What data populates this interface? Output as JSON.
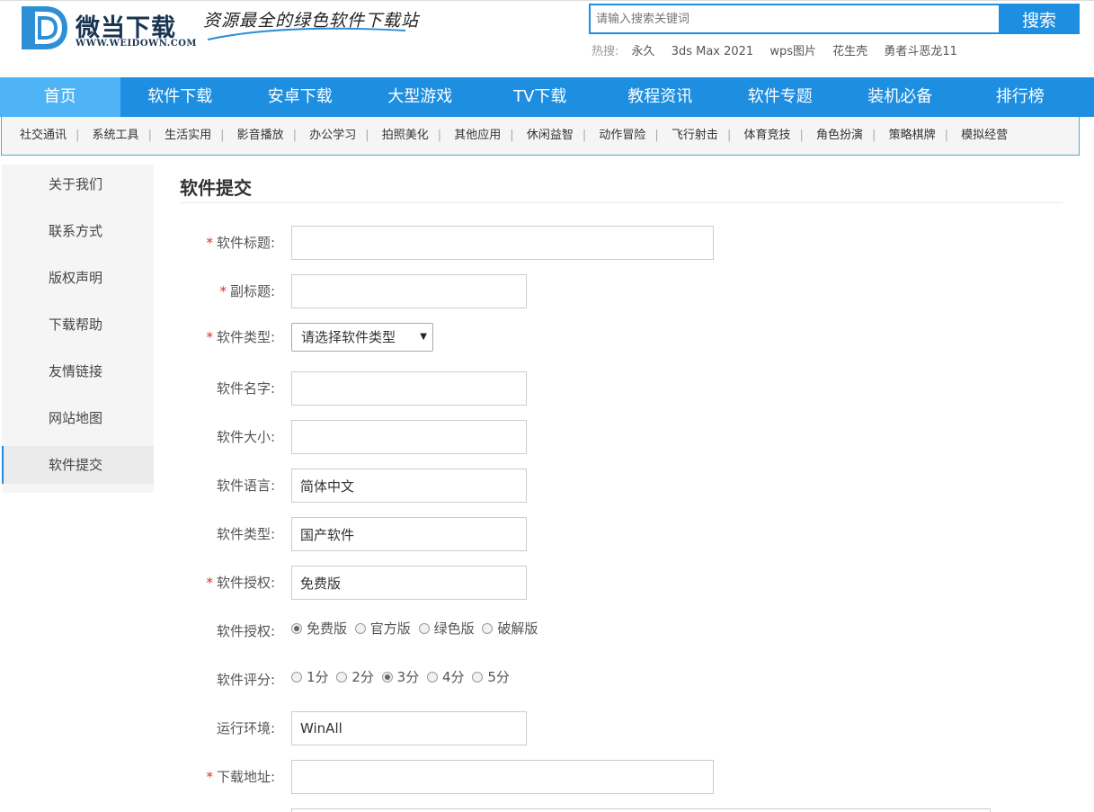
{
  "header": {
    "logo_name": "微当下载",
    "logo_url": "WWW.WEIDOWN.COM",
    "slogan": "资源最全的绿色软件下载站",
    "search": {
      "placeholder": "请输入搜索关键词",
      "button": "搜索"
    },
    "hot": {
      "label": "热搜:",
      "keywords": [
        "永久",
        "3ds Max 2021",
        "wps图片",
        "花生壳",
        "勇者斗恶龙11"
      ]
    }
  },
  "nav": {
    "items": [
      "首页",
      "软件下载",
      "安卓下载",
      "大型游戏",
      "TV下载",
      "教程资讯",
      "软件专题",
      "装机必备",
      "排行榜"
    ],
    "active": "首页"
  },
  "subnav": {
    "items": [
      "社交通讯",
      "系统工具",
      "生活实用",
      "影音播放",
      "办公学习",
      "拍照美化",
      "其他应用",
      "休闲益智",
      "动作冒险",
      "飞行射击",
      "体育竞技",
      "角色扮演",
      "策略棋牌",
      "模拟经营"
    ],
    "separator": "|"
  },
  "sidebar": {
    "items": [
      "关于我们",
      "联系方式",
      "版权声明",
      "下载帮助",
      "友情链接",
      "网站地图",
      "软件提交"
    ],
    "active": "软件提交"
  },
  "form": {
    "title": "软件提交",
    "required_mark": "*",
    "fields": {
      "title": {
        "label": "软件标题:",
        "value": ""
      },
      "subtitle": {
        "label": "副标题:",
        "value": ""
      },
      "category": {
        "label": "软件类型:",
        "selected": "请选择软件类型",
        "caret": "▼"
      },
      "name": {
        "label": "软件名字:",
        "value": ""
      },
      "size": {
        "label": "软件大小:",
        "value": ""
      },
      "language": {
        "label": "软件语言:",
        "value": "简体中文"
      },
      "type": {
        "label": "软件类型:",
        "value": "国产软件"
      },
      "license": {
        "label": "软件授权:",
        "value": "免费版"
      },
      "license_radio": {
        "label": "软件授权:",
        "options": [
          "免费版",
          "官方版",
          "绿色版",
          "破解版"
        ],
        "selected": "免费版"
      },
      "rating": {
        "label": "软件评分:",
        "options": [
          "1分",
          "2分",
          "3分",
          "4分",
          "5分"
        ],
        "selected": "3分"
      },
      "env": {
        "label": "运行环境:",
        "value": "WinAll"
      },
      "download": {
        "label": "下载地址:",
        "value": ""
      }
    }
  },
  "colors": {
    "primary": "#1e8ee0",
    "nav_active": "#4fb4f6",
    "required": "#e22222",
    "logo": "#1a3552"
  }
}
